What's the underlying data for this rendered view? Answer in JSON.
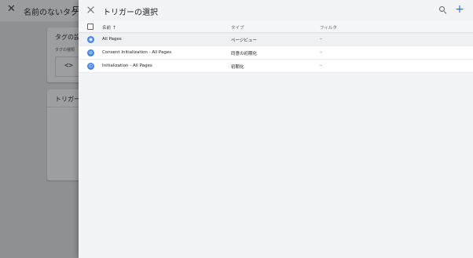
{
  "background_editor": {
    "title": "名前のないタグ",
    "tag_card_title": "タグの設定",
    "tag_type_label": "タグの種類",
    "code_icon": "code-icon",
    "trigger_card_title": "トリガー"
  },
  "panel": {
    "title": "トリガーの選択",
    "close_icon": "close-icon",
    "search_icon": "search-icon",
    "add_icon": "add-icon"
  },
  "table": {
    "columns": {
      "name": "名前",
      "type": "タイプ",
      "filter": "フィルタ"
    },
    "sort": {
      "column": "name",
      "direction": "ascending"
    },
    "rows": [
      {
        "icon": "eye-icon",
        "name": "All Pages",
        "type": "ページビュー",
        "filter": "–"
      },
      {
        "icon": "consent-icon",
        "name": "Consent Initialization - All Pages",
        "type": "同意の初期化",
        "filter": "–"
      },
      {
        "icon": "power-icon",
        "name": "Initialization - All Pages",
        "type": "初期化",
        "filter": "–"
      }
    ]
  },
  "colors": {
    "accent": "#1a73e8",
    "trigger_icon": "#4285f4",
    "panel_bg": "#f1f3f4",
    "overlay": "#8e9093"
  }
}
